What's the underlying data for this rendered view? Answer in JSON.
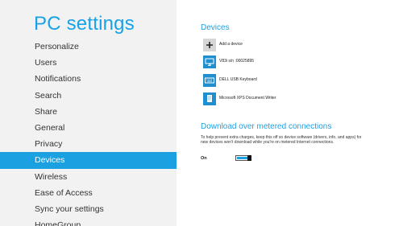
{
  "sidebar": {
    "title": "PC settings",
    "items": [
      {
        "label": "Personalize"
      },
      {
        "label": "Users"
      },
      {
        "label": "Notifications"
      },
      {
        "label": "Search"
      },
      {
        "label": "Share"
      },
      {
        "label": "General"
      },
      {
        "label": "Privacy"
      },
      {
        "label": "Devices",
        "selected": true
      },
      {
        "label": "Wireless"
      },
      {
        "label": "Ease of Access"
      },
      {
        "label": "Sync your settings"
      },
      {
        "label": "HomeGroup"
      }
    ]
  },
  "devices": {
    "title": "Devices",
    "add_label": "Add a device",
    "items": [
      {
        "label": "V83i s/n :00025895",
        "icon": "monitor-icon"
      },
      {
        "label": "DELL USB Keyboard",
        "icon": "keyboard-icon"
      },
      {
        "label": "Microsoft XPS Document Writer",
        "icon": "document-writer-icon"
      }
    ]
  },
  "metered": {
    "title": "Download over metered connections",
    "description": "To help prevent extra charges, keep this off so device software (drivers, info, and apps) for new devices won't download while you're on metered Internet connections.",
    "toggle_label": "On",
    "toggle_on": true
  },
  "colors": {
    "accent": "#1ba1e2",
    "sidebar_bg": "#f2f2f2",
    "selected_text": "#ffffff"
  }
}
